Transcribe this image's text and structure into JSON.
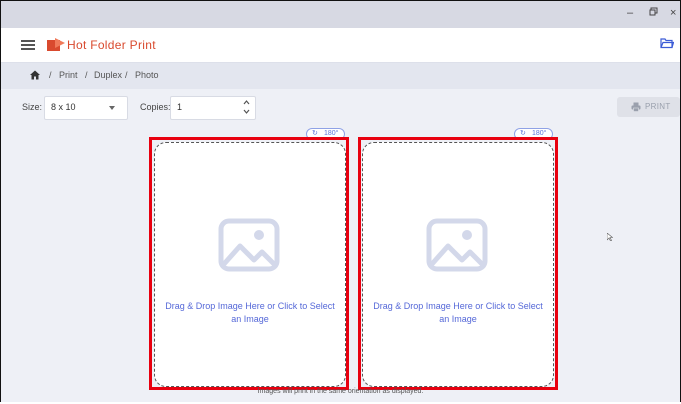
{
  "window": {
    "minimize": "–",
    "restore": "▫",
    "close": "×"
  },
  "app": {
    "title": "Hot Folder Print"
  },
  "breadcrumb": {
    "sep": "/",
    "items": [
      "Print",
      "Duplex",
      "Photo"
    ]
  },
  "toolbar": {
    "size_label": "Size:",
    "size_value": "8 x 10",
    "copies_label": "Copies:",
    "copies_value": "1",
    "print_label": "PRINT"
  },
  "panels": [
    {
      "rotate_label": "180°",
      "drop_text": "Drag & Drop Image Here or Click to Select an Image"
    },
    {
      "rotate_label": "180°",
      "drop_text": "Drag & Drop Image Here or Click to Select an Image"
    }
  ],
  "footer": {
    "note": "Images will print in the same orientation as displayed."
  },
  "colors": {
    "accent": "#5568d8",
    "brand": "#d94a2e",
    "highlight": "#e8000f"
  }
}
